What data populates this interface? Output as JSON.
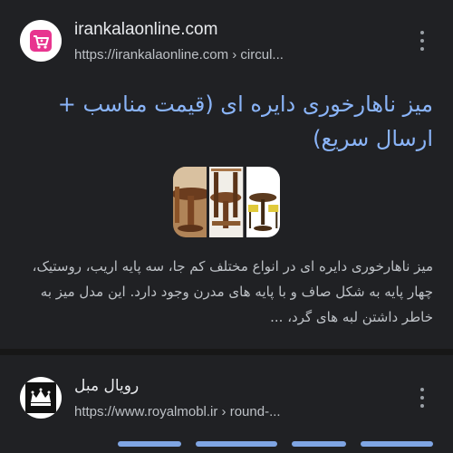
{
  "results": [
    {
      "site_name": "irankalaonline.com",
      "url": "https://irankalaonline.com › circul...",
      "title": "میز ناهارخوری دایره ای (قیمت مناسب + ارسال سریع)",
      "snippet": "میز ناهارخوری دایره ای در انواع مختلف کم جا، سه پایه اریب، روستیک، چهار پایه به شکل صاف و با پایه های مدرن وجود دارد. این مدل میز به خاطر داشتن لبه های گرد، ...",
      "favicon": "shopping-cart-icon",
      "thumbnails": [
        "round-dining-table-image-1",
        "round-dining-table-image-2",
        "round-dining-table-image-3"
      ],
      "menu_icon": "more-vert-icon"
    },
    {
      "site_name": "رویال مبل",
      "url": "https://www.royalmobl.ir › round-...",
      "favicon": "royal-crown-icon",
      "menu_icon": "more-vert-icon"
    }
  ],
  "colors": {
    "background": "#202124",
    "title_link": "#8ab4f8",
    "site_name": "#e8eaed",
    "text": "#bdc1c6",
    "favicon_pink": "#e8358f"
  }
}
